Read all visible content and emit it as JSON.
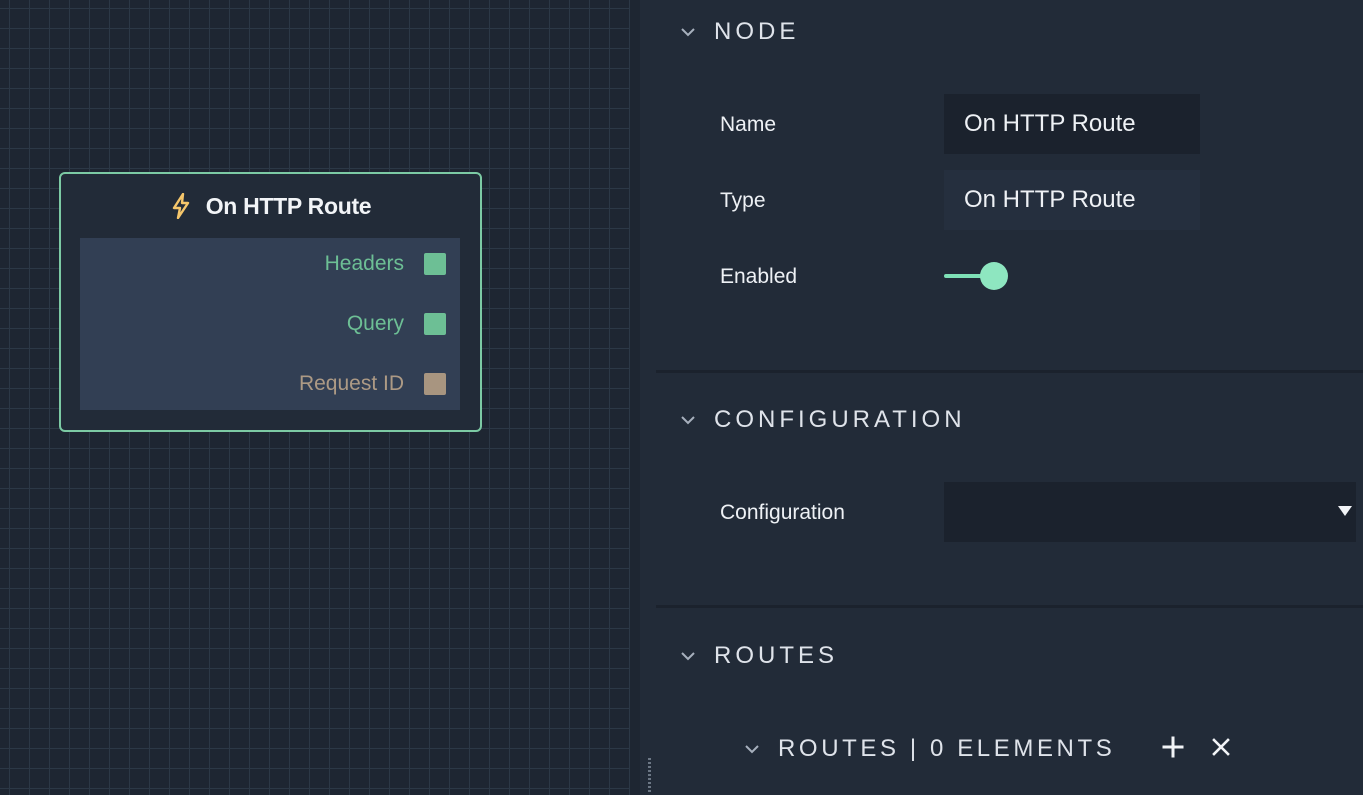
{
  "node_card": {
    "title": "On HTTP Route",
    "icon": "lightning-icon",
    "ports": [
      {
        "label": "Headers",
        "color": "#6dbf95"
      },
      {
        "label": "Query",
        "color": "#6dbf95"
      },
      {
        "label": "Request ID",
        "color": "#a89580"
      }
    ],
    "border_color": "#7ccaa4"
  },
  "inspector": {
    "node_section": {
      "title": "NODE",
      "name_label": "Name",
      "name_value": "On HTTP Route",
      "type_label": "Type",
      "type_value": "On HTTP Route",
      "enabled_label": "Enabled",
      "enabled": true
    },
    "configuration_section": {
      "title": "CONFIGURATION",
      "configuration_label": "Configuration",
      "configuration_value": ""
    },
    "routes_section": {
      "title": "ROUTES",
      "list_title": "ROUTES | 0 ELEMENTS",
      "add_icon": "plus-icon",
      "clear_icon": "close-icon"
    },
    "accent_color": "#7ee0b6"
  }
}
